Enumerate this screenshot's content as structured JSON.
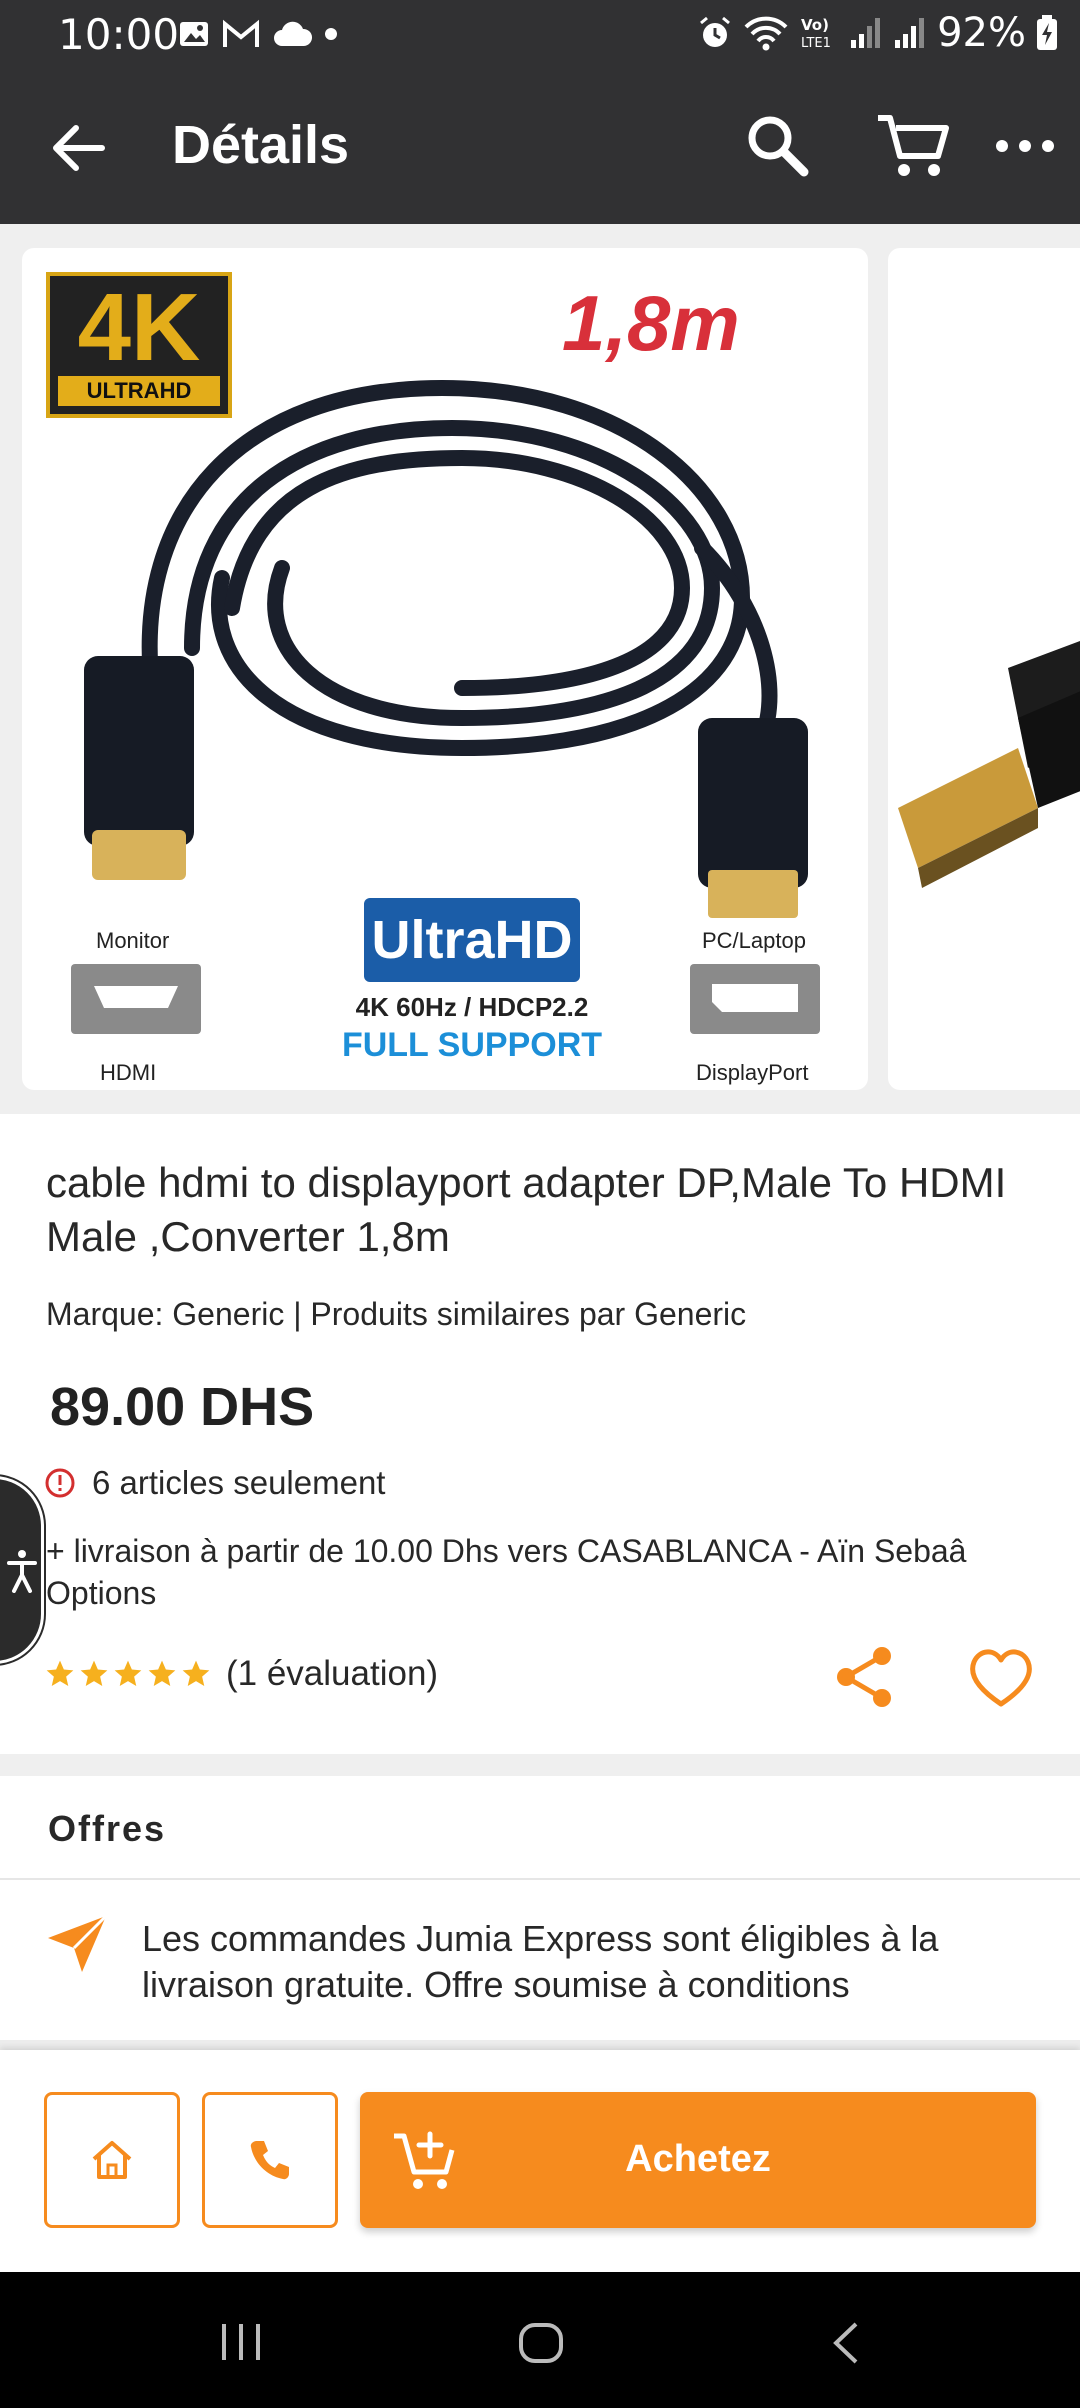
{
  "status_bar": {
    "time": "10:00",
    "battery": "92%",
    "left_icons": [
      "gallery-icon",
      "gmail-icon",
      "cloud-icon",
      "dot-icon"
    ],
    "right_icons": [
      "alarm-icon",
      "wifi-icon",
      "volte-icon",
      "signal-icon",
      "signal-icon",
      "battery-charging-icon"
    ],
    "volte_label": "Vo) LTE1"
  },
  "app_bar": {
    "title": "Détails",
    "icons": [
      "back-arrow-icon",
      "search-icon",
      "cart-icon",
      "more-icon"
    ]
  },
  "gallery": {
    "badge_main": "4K",
    "badge_sub": "ULTRAHD",
    "length": "1,8m",
    "left_port_top": "Monitor",
    "left_port_bottom": "HDMI",
    "right_port_top": "PC/Laptop",
    "right_port_bottom": "DisplayPort",
    "uhd_title": "UltraHD",
    "uhd_spec": "4K 60Hz / HDCP2.2",
    "uhd_support": "FULL SUPPORT"
  },
  "product": {
    "title": "cable hdmi to displayport adapter DP,Male To HDMI Male ,Converter 1,8m",
    "brand_line": "Marque: Generic | Produits similaires par Generic",
    "price": "89.00 DHS",
    "stock": "6 articles seulement",
    "delivery": "+ livraison à partir de 10.00 Dhs vers CASABLANCA - Aïn Sebaâ Options",
    "rating_stars": 5,
    "rating_text": "(1 évaluation)"
  },
  "offers": {
    "title": "Offres",
    "items": [
      {
        "text": "Les commandes Jumia Express sont éligibles à la livraison gratuite. Offre soumise à conditions"
      }
    ]
  },
  "bottom_bar": {
    "buy_label": "Achetez"
  },
  "colors": {
    "accent": "#f68b1e",
    "header_bg": "#313133",
    "star": "#f6b01e",
    "alert": "#d32f2f"
  }
}
